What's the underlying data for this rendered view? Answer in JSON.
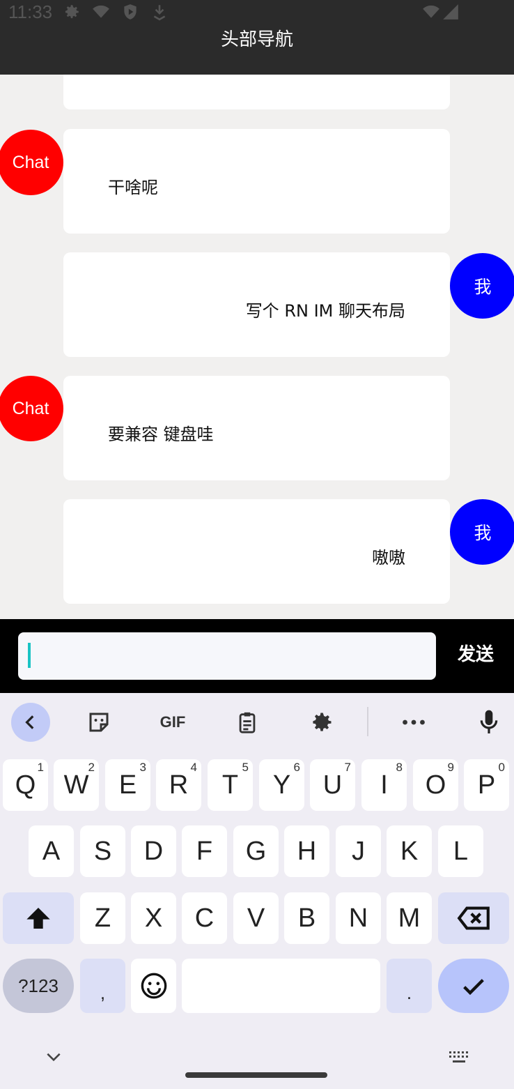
{
  "status_bar": {
    "time": "11:33"
  },
  "header": {
    "title": "头部导航"
  },
  "messages": [
    {
      "sender": "other",
      "avatar": "Chat",
      "text": "干啥呢"
    },
    {
      "sender": "me",
      "avatar": "我",
      "text": "写个 RN IM 聊天布局"
    },
    {
      "sender": "other",
      "avatar": "Chat",
      "text": "要兼容 键盘哇"
    },
    {
      "sender": "me",
      "avatar": "我",
      "text": "嗷嗷"
    }
  ],
  "input": {
    "value": "",
    "placeholder": ""
  },
  "send_label": "发送",
  "keyboard": {
    "row1": [
      {
        "key": "Q",
        "hint": "1"
      },
      {
        "key": "W",
        "hint": "2"
      },
      {
        "key": "E",
        "hint": "3"
      },
      {
        "key": "R",
        "hint": "4"
      },
      {
        "key": "T",
        "hint": "5"
      },
      {
        "key": "Y",
        "hint": "6"
      },
      {
        "key": "U",
        "hint": "7"
      },
      {
        "key": "I",
        "hint": "8"
      },
      {
        "key": "O",
        "hint": "9"
      },
      {
        "key": "P",
        "hint": "0"
      }
    ],
    "row2": [
      "A",
      "S",
      "D",
      "F",
      "G",
      "H",
      "J",
      "K",
      "L"
    ],
    "row3": [
      "Z",
      "X",
      "C",
      "V",
      "B",
      "N",
      "M"
    ],
    "sym_label": "?123",
    "comma": ",",
    "period": ".",
    "gif_label": "GIF"
  },
  "colors": {
    "header": "#2b2b2b",
    "other_avatar": "#ff0000",
    "me_avatar": "#0000ff",
    "accent": "#b7c4fb"
  }
}
